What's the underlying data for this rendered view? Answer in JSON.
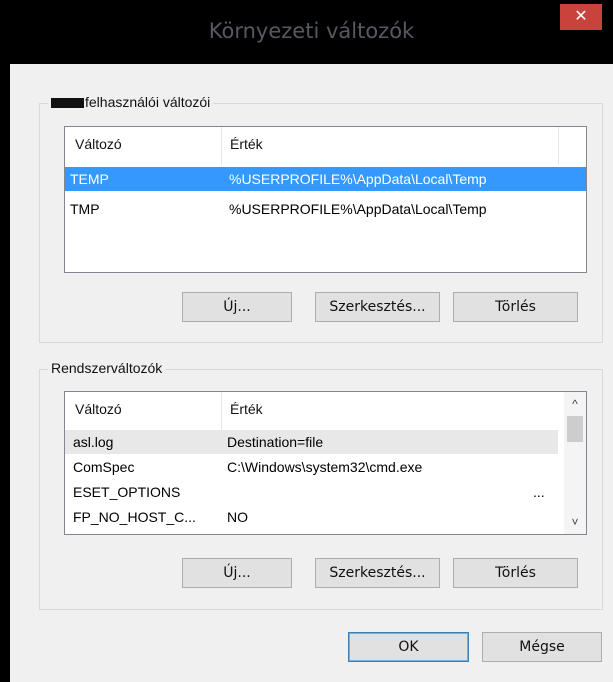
{
  "window": {
    "title": "Környezeti változók",
    "close_glyph": "✕"
  },
  "user_vars": {
    "legend_suffix": "felhasználói változói",
    "columns": [
      "Változó",
      "Érték"
    ],
    "rows": [
      {
        "name": "TEMP",
        "value": "%USERPROFILE%\\AppData\\Local\\Temp",
        "selected": true
      },
      {
        "name": "TMP",
        "value": "%USERPROFILE%\\AppData\\Local\\Temp",
        "selected": false
      }
    ],
    "buttons": {
      "new": "Új...",
      "edit": "Szerkesztés...",
      "delete": "Törlés"
    }
  },
  "system_vars": {
    "legend": "Rendszerváltozók",
    "columns": [
      "Változó",
      "Érték"
    ],
    "rows": [
      {
        "name": "asl.log",
        "value": "Destination=file"
      },
      {
        "name": "ComSpec",
        "value": "C:\\Windows\\system32\\cmd.exe"
      },
      {
        "name": "ESET_OPTIONS",
        "value": "..."
      },
      {
        "name": "FP_NO_HOST_C...",
        "value": "NO"
      }
    ],
    "scroll_up": "^",
    "scroll_down": "˅",
    "buttons": {
      "new": "Új...",
      "edit": "Szerkesztés...",
      "delete": "Törlés"
    }
  },
  "footer": {
    "ok": "OK",
    "cancel": "Mégse"
  }
}
